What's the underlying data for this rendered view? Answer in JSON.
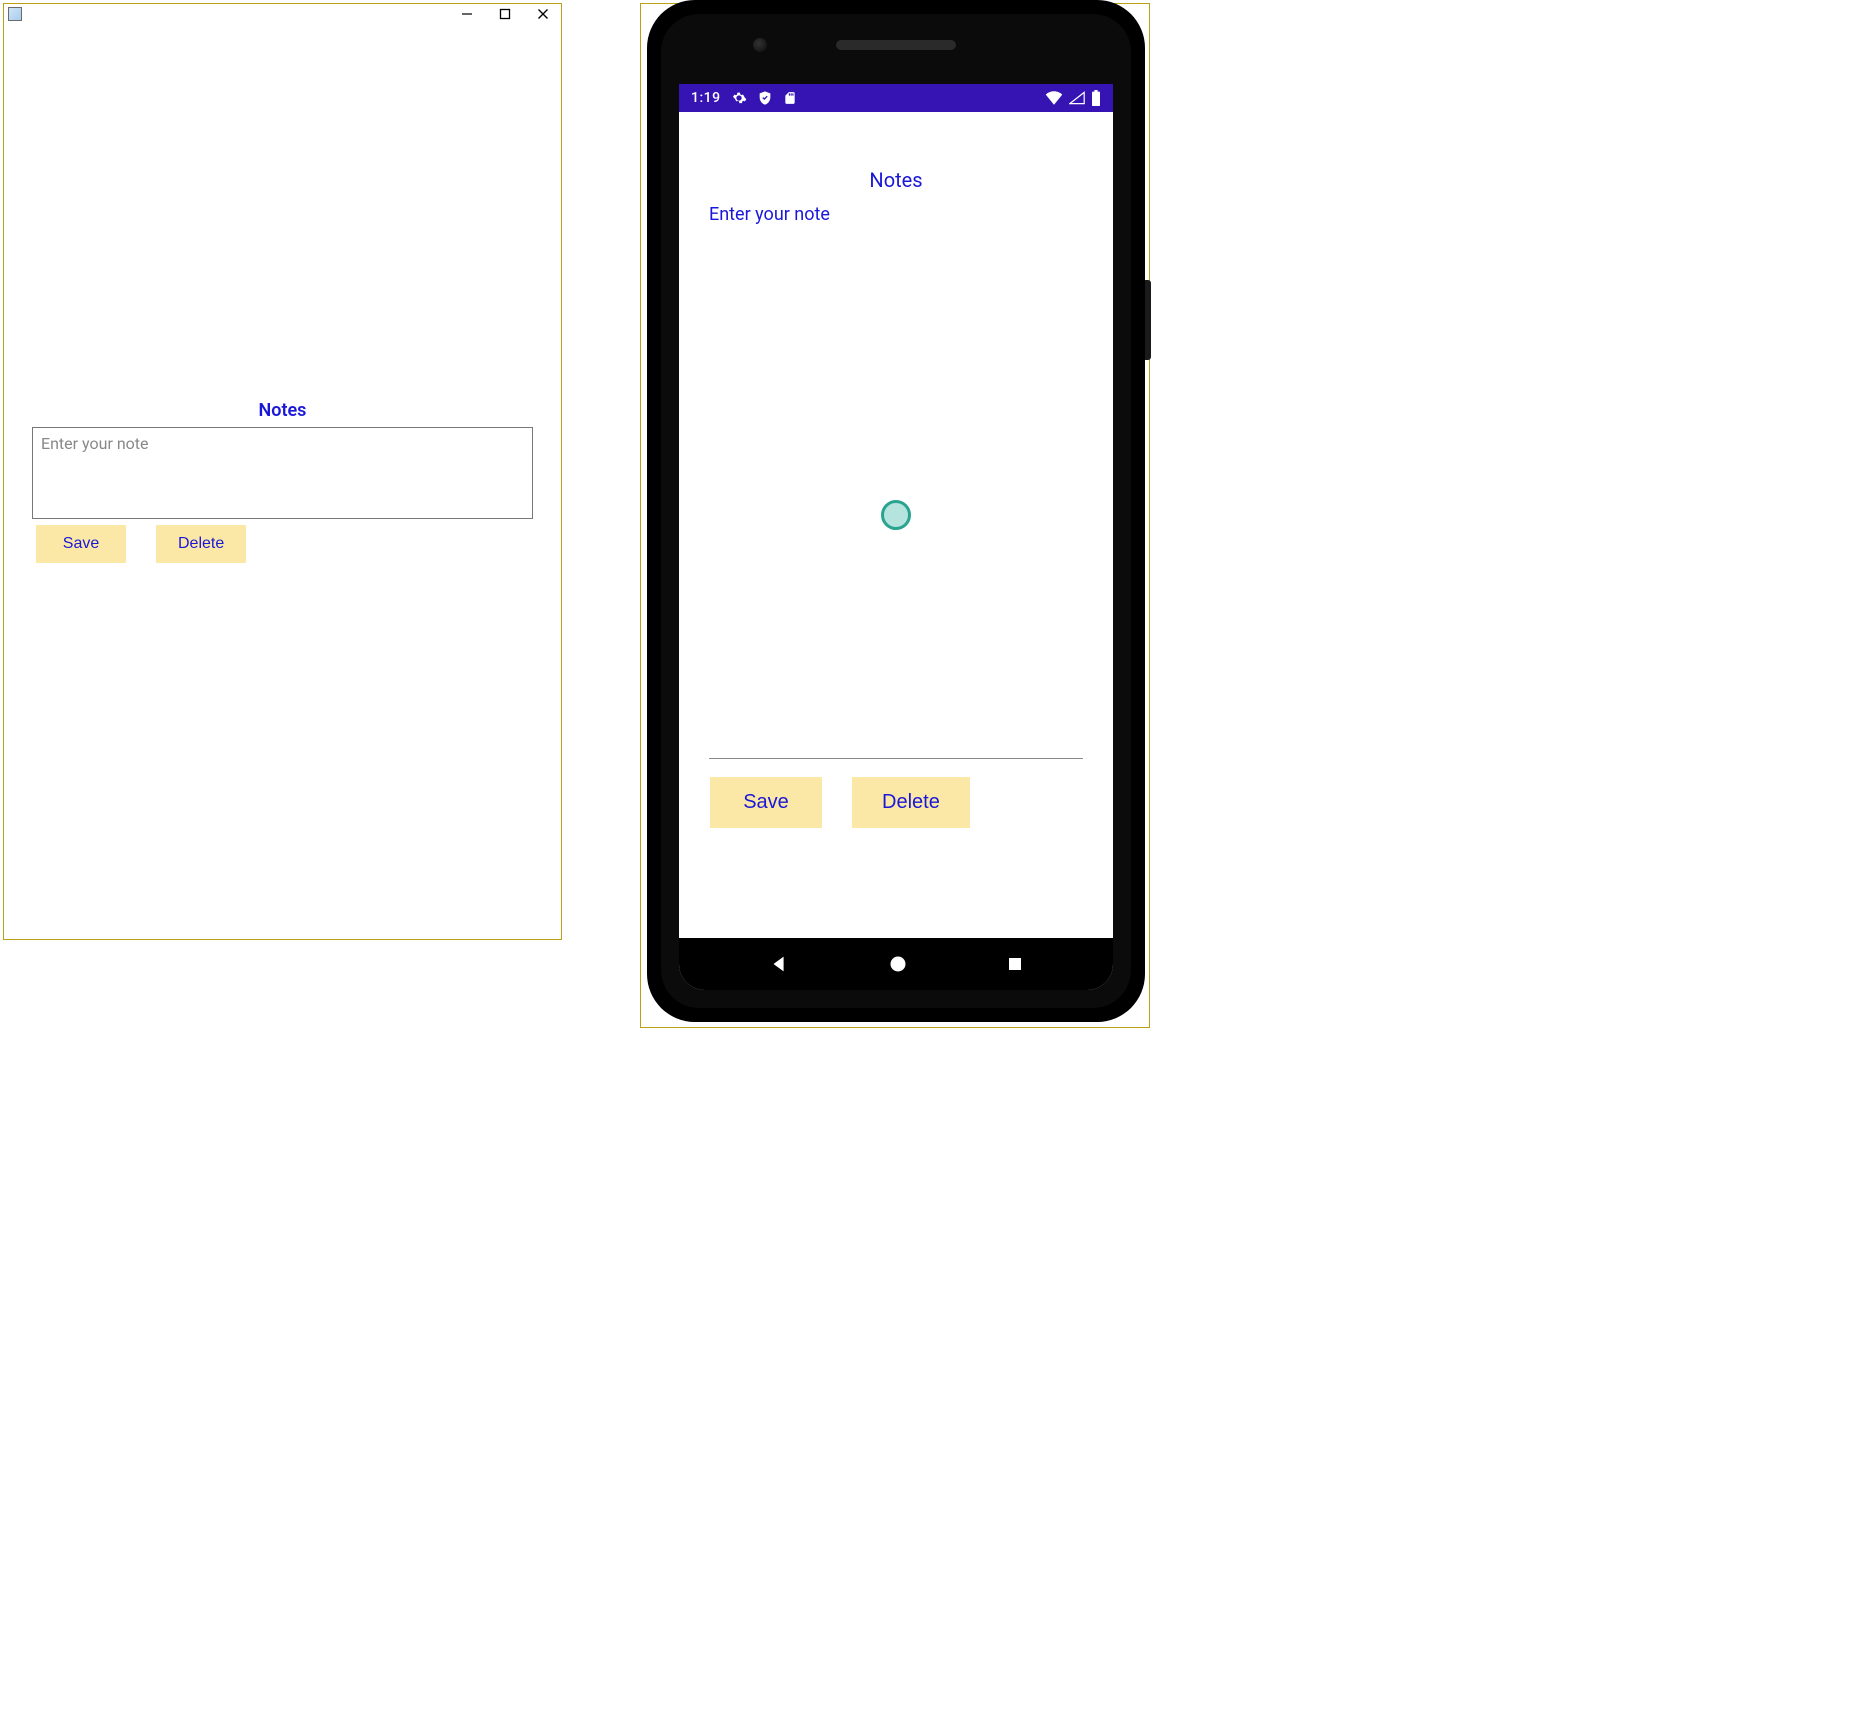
{
  "colors": {
    "accent": "#1a18d8",
    "button_bg": "#fce8a6",
    "statusbar_bg": "#3514b3",
    "border_highlight": "#b8a114"
  },
  "desktop": {
    "heading": "Notes",
    "placeholder": "Enter your note",
    "value": "",
    "save_label": "Save",
    "delete_label": "Delete"
  },
  "phone": {
    "status": {
      "time": "1:19",
      "icons_left": [
        "gear-icon",
        "shield-icon",
        "sd-card-icon"
      ],
      "icons_right": [
        "wifi-icon",
        "signal-icon",
        "battery-icon"
      ]
    },
    "heading": "Notes",
    "placeholder": "Enter your note",
    "value": "",
    "save_label": "Save",
    "delete_label": "Delete",
    "nav_icons": [
      "nav-back-icon",
      "nav-home-icon",
      "nav-recent-icon"
    ]
  }
}
